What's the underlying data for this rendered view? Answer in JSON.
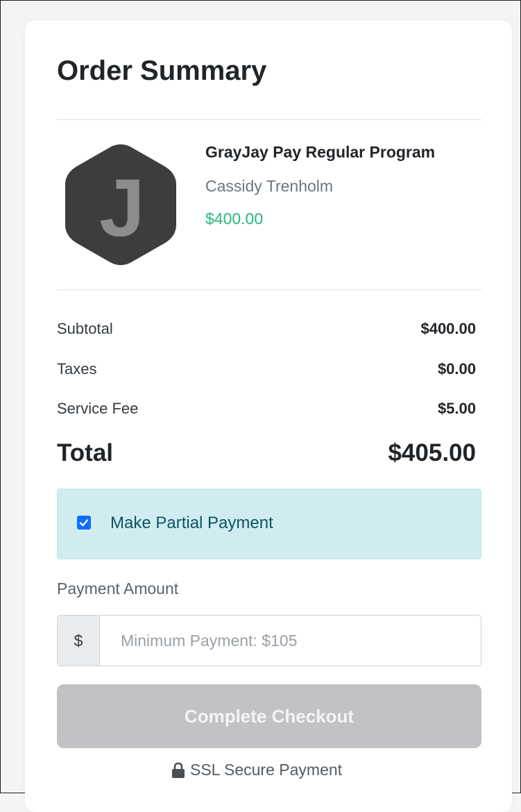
{
  "summary": {
    "title": "Order Summary"
  },
  "product": {
    "logo_letter": "J",
    "name": "GrayJay Pay Regular Program",
    "seller": "Cassidy Trenholm",
    "price": "$400.00"
  },
  "totals": {
    "subtotal_label": "Subtotal",
    "subtotal_value": "$400.00",
    "taxes_label": "Taxes",
    "taxes_value": "$0.00",
    "fee_label": "Service Fee",
    "fee_value": "$5.00",
    "total_label": "Total",
    "total_value": "$405.00"
  },
  "partial": {
    "label": "Make Partial Payment",
    "checked": true
  },
  "payment": {
    "label": "Payment Amount",
    "currency_symbol": "$",
    "placeholder": "Minimum Payment: $105",
    "value": ""
  },
  "checkout": {
    "button_label": "Complete Checkout",
    "disabled": true
  },
  "security": {
    "label": "SSL Secure Payment",
    "icon": "lock-icon"
  },
  "colors": {
    "accent_green": "#26b77e",
    "alert_bg": "#d1ecf1",
    "alert_text": "#0c5460",
    "button_disabled": "#c0c2c5",
    "checkbox": "#0d6efd"
  }
}
